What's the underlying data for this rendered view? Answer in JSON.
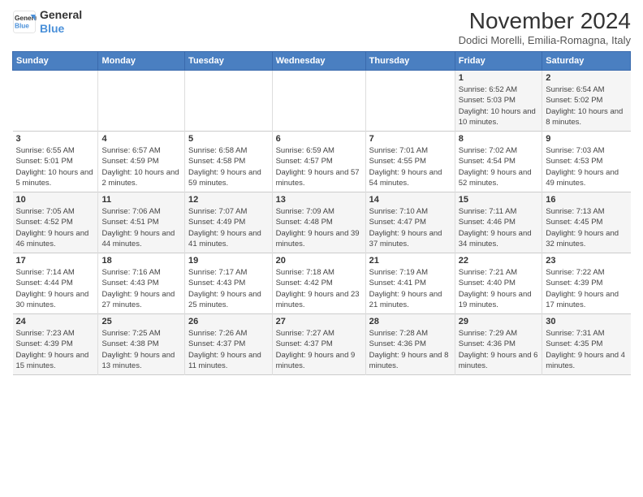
{
  "logo": {
    "line1": "General",
    "line2": "Blue"
  },
  "title": "November 2024",
  "subtitle": "Dodici Morelli, Emilia-Romagna, Italy",
  "headers": [
    "Sunday",
    "Monday",
    "Tuesday",
    "Wednesday",
    "Thursday",
    "Friday",
    "Saturday"
  ],
  "weeks": [
    [
      {
        "day": "",
        "info": ""
      },
      {
        "day": "",
        "info": ""
      },
      {
        "day": "",
        "info": ""
      },
      {
        "day": "",
        "info": ""
      },
      {
        "day": "",
        "info": ""
      },
      {
        "day": "1",
        "info": "Sunrise: 6:52 AM\nSunset: 5:03 PM\nDaylight: 10 hours and 10 minutes."
      },
      {
        "day": "2",
        "info": "Sunrise: 6:54 AM\nSunset: 5:02 PM\nDaylight: 10 hours and 8 minutes."
      }
    ],
    [
      {
        "day": "3",
        "info": "Sunrise: 6:55 AM\nSunset: 5:01 PM\nDaylight: 10 hours and 5 minutes."
      },
      {
        "day": "4",
        "info": "Sunrise: 6:57 AM\nSunset: 4:59 PM\nDaylight: 10 hours and 2 minutes."
      },
      {
        "day": "5",
        "info": "Sunrise: 6:58 AM\nSunset: 4:58 PM\nDaylight: 9 hours and 59 minutes."
      },
      {
        "day": "6",
        "info": "Sunrise: 6:59 AM\nSunset: 4:57 PM\nDaylight: 9 hours and 57 minutes."
      },
      {
        "day": "7",
        "info": "Sunrise: 7:01 AM\nSunset: 4:55 PM\nDaylight: 9 hours and 54 minutes."
      },
      {
        "day": "8",
        "info": "Sunrise: 7:02 AM\nSunset: 4:54 PM\nDaylight: 9 hours and 52 minutes."
      },
      {
        "day": "9",
        "info": "Sunrise: 7:03 AM\nSunset: 4:53 PM\nDaylight: 9 hours and 49 minutes."
      }
    ],
    [
      {
        "day": "10",
        "info": "Sunrise: 7:05 AM\nSunset: 4:52 PM\nDaylight: 9 hours and 46 minutes."
      },
      {
        "day": "11",
        "info": "Sunrise: 7:06 AM\nSunset: 4:51 PM\nDaylight: 9 hours and 44 minutes."
      },
      {
        "day": "12",
        "info": "Sunrise: 7:07 AM\nSunset: 4:49 PM\nDaylight: 9 hours and 41 minutes."
      },
      {
        "day": "13",
        "info": "Sunrise: 7:09 AM\nSunset: 4:48 PM\nDaylight: 9 hours and 39 minutes."
      },
      {
        "day": "14",
        "info": "Sunrise: 7:10 AM\nSunset: 4:47 PM\nDaylight: 9 hours and 37 minutes."
      },
      {
        "day": "15",
        "info": "Sunrise: 7:11 AM\nSunset: 4:46 PM\nDaylight: 9 hours and 34 minutes."
      },
      {
        "day": "16",
        "info": "Sunrise: 7:13 AM\nSunset: 4:45 PM\nDaylight: 9 hours and 32 minutes."
      }
    ],
    [
      {
        "day": "17",
        "info": "Sunrise: 7:14 AM\nSunset: 4:44 PM\nDaylight: 9 hours and 30 minutes."
      },
      {
        "day": "18",
        "info": "Sunrise: 7:16 AM\nSunset: 4:43 PM\nDaylight: 9 hours and 27 minutes."
      },
      {
        "day": "19",
        "info": "Sunrise: 7:17 AM\nSunset: 4:43 PM\nDaylight: 9 hours and 25 minutes."
      },
      {
        "day": "20",
        "info": "Sunrise: 7:18 AM\nSunset: 4:42 PM\nDaylight: 9 hours and 23 minutes."
      },
      {
        "day": "21",
        "info": "Sunrise: 7:19 AM\nSunset: 4:41 PM\nDaylight: 9 hours and 21 minutes."
      },
      {
        "day": "22",
        "info": "Sunrise: 7:21 AM\nSunset: 4:40 PM\nDaylight: 9 hours and 19 minutes."
      },
      {
        "day": "23",
        "info": "Sunrise: 7:22 AM\nSunset: 4:39 PM\nDaylight: 9 hours and 17 minutes."
      }
    ],
    [
      {
        "day": "24",
        "info": "Sunrise: 7:23 AM\nSunset: 4:39 PM\nDaylight: 9 hours and 15 minutes."
      },
      {
        "day": "25",
        "info": "Sunrise: 7:25 AM\nSunset: 4:38 PM\nDaylight: 9 hours and 13 minutes."
      },
      {
        "day": "26",
        "info": "Sunrise: 7:26 AM\nSunset: 4:37 PM\nDaylight: 9 hours and 11 minutes."
      },
      {
        "day": "27",
        "info": "Sunrise: 7:27 AM\nSunset: 4:37 PM\nDaylight: 9 hours and 9 minutes."
      },
      {
        "day": "28",
        "info": "Sunrise: 7:28 AM\nSunset: 4:36 PM\nDaylight: 9 hours and 8 minutes."
      },
      {
        "day": "29",
        "info": "Sunrise: 7:29 AM\nSunset: 4:36 PM\nDaylight: 9 hours and 6 minutes."
      },
      {
        "day": "30",
        "info": "Sunrise: 7:31 AM\nSunset: 4:35 PM\nDaylight: 9 hours and 4 minutes."
      }
    ]
  ]
}
